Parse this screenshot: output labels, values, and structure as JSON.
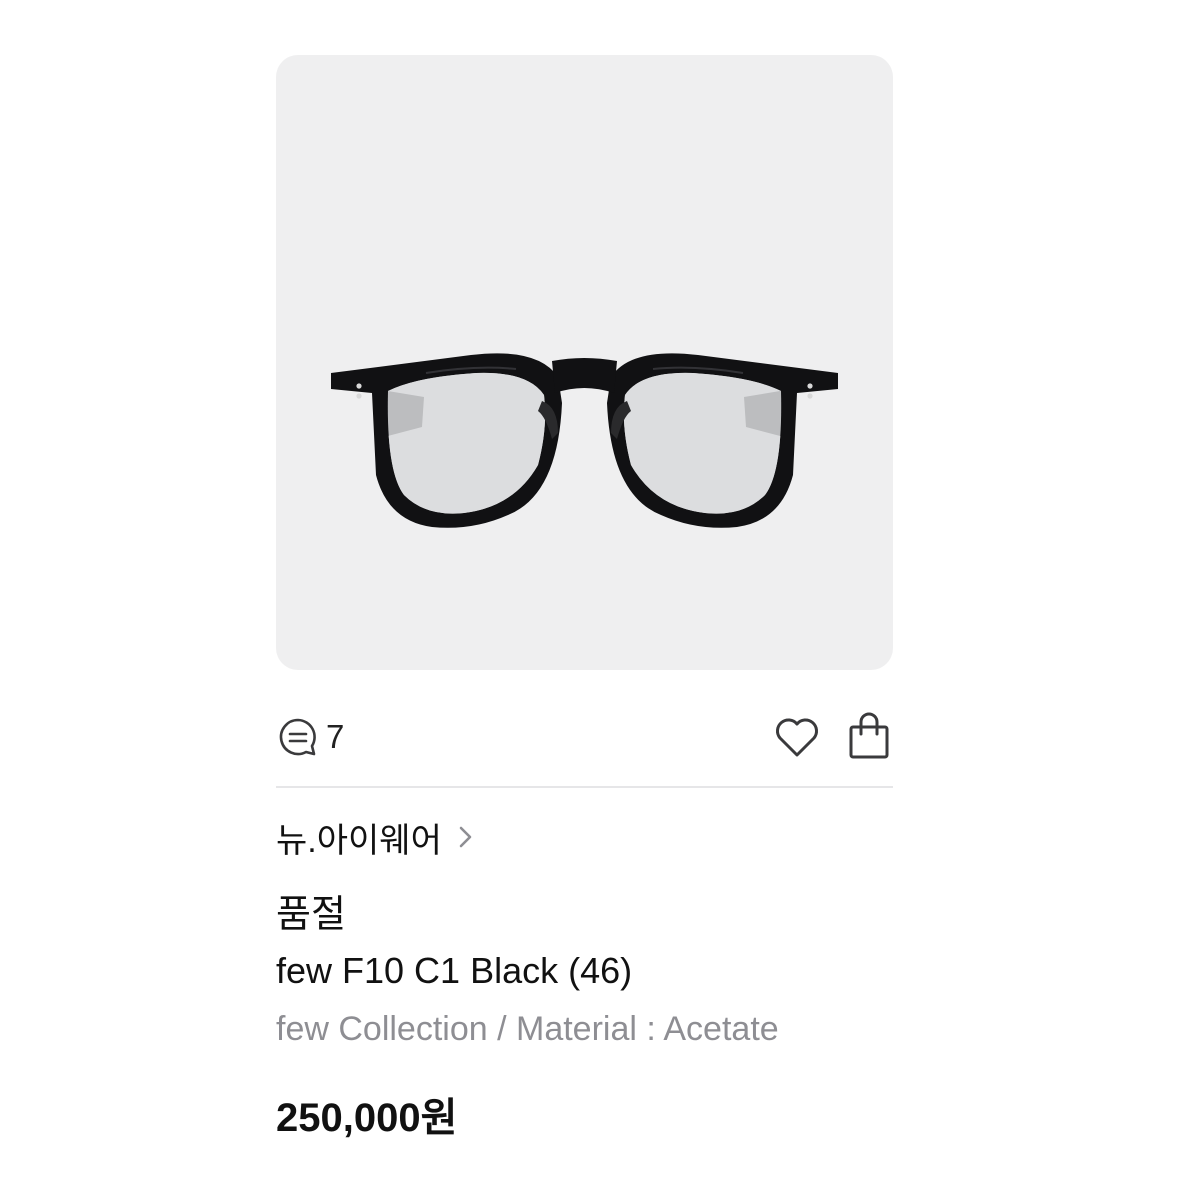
{
  "product": {
    "image_alt": "black acetate eyeglasses",
    "comments_count": "7",
    "seller_name": "뉴.아이웨어",
    "status": "품절",
    "title": "few F10 C1 Black (46)",
    "subtitle": "few Collection / Material : Acetate",
    "price": "250,000원"
  },
  "icons": {
    "comment": "comment-bubble-icon",
    "like": "heart-icon",
    "cart": "shopping-bag-icon",
    "seller_link": "chevron-right-icon"
  },
  "colors": {
    "image_background": "#efeff0",
    "subtitle_text": "#8e8e93",
    "divider": "#e6e6e8",
    "primary_text": "#111111"
  }
}
